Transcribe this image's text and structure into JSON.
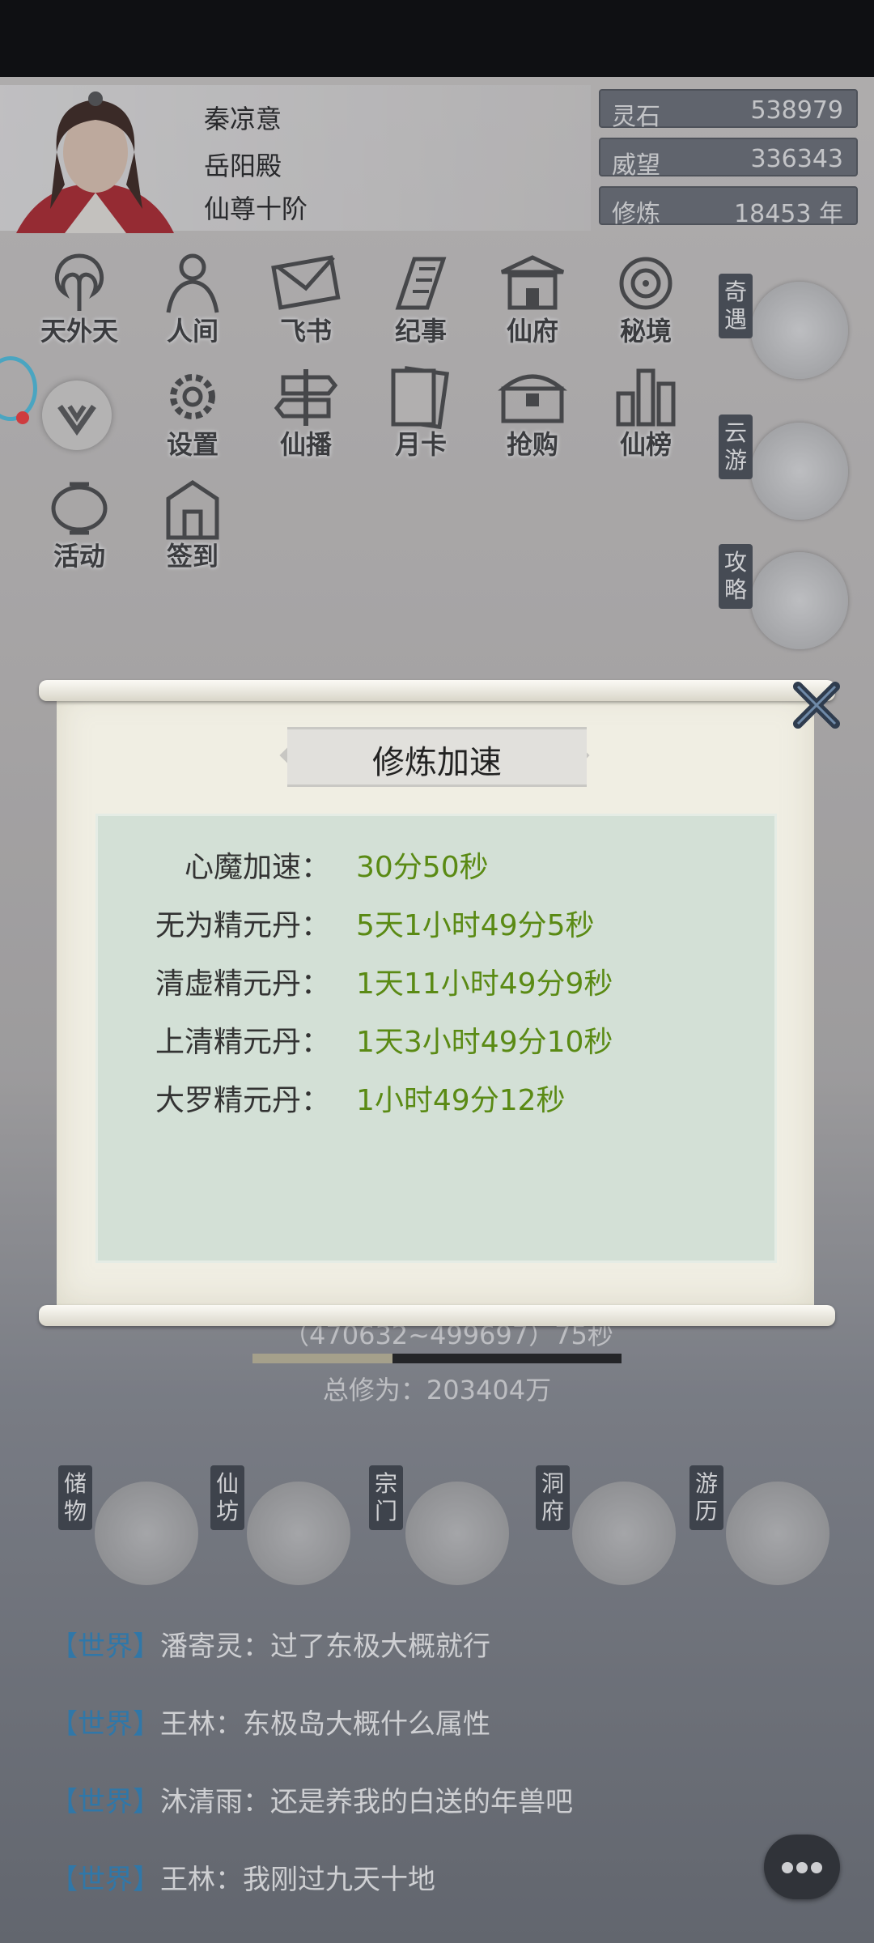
{
  "player": {
    "name": "秦凉意",
    "sect": "岳阳殿",
    "rank": "仙尊十阶"
  },
  "stats": [
    {
      "label": "灵石",
      "value": "538979"
    },
    {
      "label": "威望",
      "value": "336343"
    },
    {
      "label": "修炼",
      "value": "18453 年"
    }
  ],
  "menu": [
    {
      "label": "天外天",
      "icon": "heaven-icon"
    },
    {
      "label": "人间",
      "icon": "human-realm-icon"
    },
    {
      "label": "飞书",
      "icon": "letter-icon"
    },
    {
      "label": "纪事",
      "icon": "scroll-record-icon"
    },
    {
      "label": "仙府",
      "icon": "mansion-icon"
    },
    {
      "label": "秘境",
      "icon": "secret-realm-icon"
    },
    {
      "label": "设置",
      "icon": "gear-icon"
    },
    {
      "label": "仙播",
      "icon": "signpost-icon"
    },
    {
      "label": "月卡",
      "icon": "moon-card-icon"
    },
    {
      "label": "抢购",
      "icon": "chest-icon"
    },
    {
      "label": "仙榜",
      "icon": "ranking-icon"
    },
    {
      "label": "活动",
      "icon": "lantern-icon"
    },
    {
      "label": "签到",
      "icon": "checkin-icon"
    }
  ],
  "side_buttons": [
    {
      "label": "奇遇",
      "icon": "teapot-icon"
    },
    {
      "label": "云游",
      "icon": "crane-icon"
    },
    {
      "label": "攻略",
      "icon": "book-icon"
    }
  ],
  "dialog": {
    "title": "修炼加速",
    "rows": [
      {
        "key": "心魔加速：",
        "value": "30分50秒"
      },
      {
        "key": "无为精元丹：",
        "value": "5天1小时49分5秒"
      },
      {
        "key": "清虚精元丹：",
        "value": "1天11小时49分9秒"
      },
      {
        "key": "上清精元丹：",
        "value": "1天3小时49分10秒"
      },
      {
        "key": "大罗精元丹：",
        "value": "1小时49分12秒"
      }
    ]
  },
  "cultivation": {
    "range_text": "（470632~499697）75秒",
    "progress": 0.38,
    "total": "总修为：203404万"
  },
  "bottom_buttons": [
    {
      "label": "储物",
      "icon": "bag-icon"
    },
    {
      "label": "仙坊",
      "icon": "ingot-icon"
    },
    {
      "label": "宗门",
      "icon": "gate-icon"
    },
    {
      "label": "洞府",
      "icon": "pavilion-icon"
    },
    {
      "label": "游历",
      "icon": "travel-icon"
    }
  ],
  "chat": [
    {
      "channel": "【世界】",
      "text": "潘寄灵：过了东极大概就行"
    },
    {
      "channel": "【世界】",
      "text": "王林：东极岛大概什么属性"
    },
    {
      "channel": "【世界】",
      "text": "沐清雨：还是养我的白送的年兽吧"
    },
    {
      "channel": "【世界】",
      "text": "王林：我刚过九天十地"
    }
  ],
  "colors": {
    "value_green": "#5a8a14",
    "channel_blue": "#2c8ac7",
    "stat_bg": "#6d7179"
  }
}
